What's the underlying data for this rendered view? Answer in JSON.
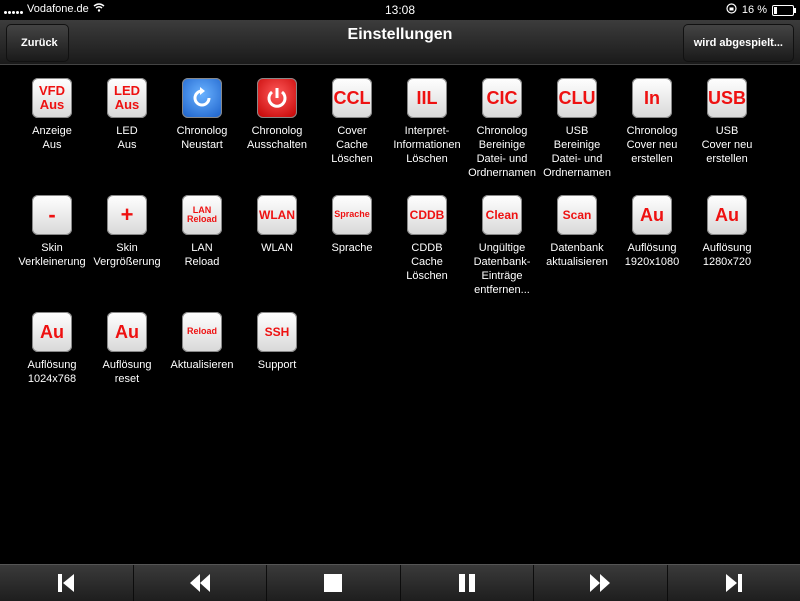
{
  "status": {
    "carrier": "Vodafone.de",
    "time": "13:08",
    "battery": "16 %",
    "battery_level": 0.16
  },
  "navbar": {
    "title": "Einstellungen",
    "back_label": "Zurück",
    "right_label": "wird abgespielt..."
  },
  "tiles": [
    {
      "icon": "VFD\nAus",
      "label": "Anzeige\nAus",
      "kind": "two"
    },
    {
      "icon": "LED\nAus",
      "label": "LED\nAus",
      "kind": "two"
    },
    {
      "icon": "",
      "label": "Chronolog\nNeustart",
      "kind": "blue"
    },
    {
      "icon": "",
      "label": "Chronolog\nAusschalten",
      "kind": "red"
    },
    {
      "icon": "CCL",
      "label": "Cover\nCache\nLöschen",
      "kind": "big"
    },
    {
      "icon": "IIL",
      "label": "Interpret-\nInformationen\nLöschen",
      "kind": "big"
    },
    {
      "icon": "CIC",
      "label": "Chronolog\nBereinige\nDatei- und\nOrdnernamen",
      "kind": "big"
    },
    {
      "icon": "CLU",
      "label": "USB\nBereinige\nDatei- und\nOrdnernamen",
      "kind": "big"
    },
    {
      "icon": "In",
      "label": "Chronolog\nCover neu\nerstellen",
      "kind": "big"
    },
    {
      "icon": "USB",
      "label": "USB\nCover neu\nerstellen",
      "kind": "big"
    },
    {
      "icon": "-",
      "label": "Skin\nVerkleinerung",
      "kind": "sym"
    },
    {
      "icon": "+",
      "label": "Skin\nVergrößerung",
      "kind": "sym"
    },
    {
      "icon": "LAN\nReload",
      "label": "LAN\nReload",
      "kind": "small"
    },
    {
      "icon": "WLAN",
      "label": "WLAN",
      "kind": "med"
    },
    {
      "icon": "Sprache",
      "label": "Sprache",
      "kind": "small"
    },
    {
      "icon": "CDDB",
      "label": "CDDB\nCache\nLöschen",
      "kind": "med"
    },
    {
      "icon": "Clean",
      "label": "Ungültige\nDatenbank-\nEinträge\nentfernen...",
      "kind": "med"
    },
    {
      "icon": "Scan",
      "label": "Datenbank\naktualisieren",
      "kind": "med"
    },
    {
      "icon": "Au",
      "label": "Auflösung\n1920x1080",
      "kind": "big"
    },
    {
      "icon": "Au",
      "label": "Auflösung\n1280x720",
      "kind": "big"
    },
    {
      "icon": "Au",
      "label": "Auflösung\n1024x768",
      "kind": "big"
    },
    {
      "icon": "Au",
      "label": "Auflösung\nreset",
      "kind": "big"
    },
    {
      "icon": "Reload",
      "label": "Aktualisieren",
      "kind": "small"
    },
    {
      "icon": "SSH",
      "label": "Support",
      "kind": "med"
    }
  ],
  "controls": [
    "skip-back-icon",
    "rewind-icon",
    "stop-icon",
    "pause-icon",
    "fast-forward-icon",
    "skip-forward-icon"
  ]
}
